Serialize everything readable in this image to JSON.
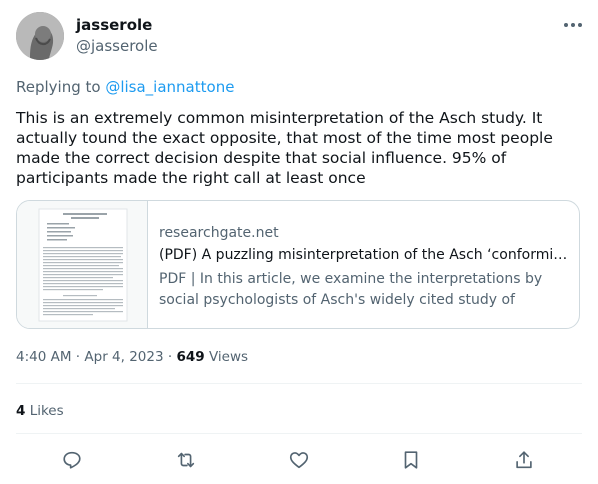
{
  "author": {
    "display_name": "jasserole",
    "handle": "@jasserole"
  },
  "reply": {
    "prefix": "Replying to ",
    "mention": "@lisa_iannattone"
  },
  "tweet": {
    "text": "This is an extremely common misinterpretation of the Asch study. It actually tound the exact opposite, that most of the time most people made the correct decision despite that social influence. 95% of participants made the right call at least once"
  },
  "link_card": {
    "domain": "researchgate.net",
    "title": "(PDF) A puzzling misinterpretation of the Asch ‘conformity’ s…",
    "description": "PDF | In this article, we examine the interpretations by social psychologists of Asch's widely cited study of independence …"
  },
  "meta": {
    "time": "4:40 AM",
    "separator": "·",
    "date": "Apr 4, 2023",
    "views_count": "649",
    "views_label": "Views"
  },
  "stats": {
    "likes_count": "4",
    "likes_label": "Likes"
  },
  "actions": [
    "reply-icon",
    "retweet-icon",
    "like-icon",
    "bookmark-icon",
    "share-icon"
  ],
  "colors": {
    "accent": "#1d9bf0",
    "secondary_text": "#536471",
    "primary_text": "#0f1419",
    "border": "#cfd9de"
  }
}
